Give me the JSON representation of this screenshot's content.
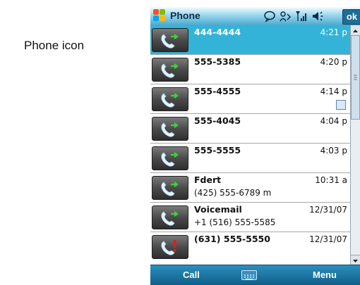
{
  "caption": "Phone icon",
  "titlebar": {
    "title": "Phone",
    "ok_label": "ok"
  },
  "calls": [
    {
      "name": "444-4444",
      "time": "4:21 p",
      "sub": "",
      "missed": false,
      "selected": true,
      "note": false
    },
    {
      "name": "555-5385",
      "time": "4:20 p",
      "sub": "",
      "missed": false,
      "selected": false,
      "note": false
    },
    {
      "name": "555-4555",
      "time": "4:14 p",
      "sub": "",
      "missed": false,
      "selected": false,
      "note": true
    },
    {
      "name": "555-4045",
      "time": "4:04 p",
      "sub": "",
      "missed": false,
      "selected": false,
      "note": false
    },
    {
      "name": "555-5555",
      "time": "4:03 p",
      "sub": "",
      "missed": false,
      "selected": false,
      "note": false
    },
    {
      "name": "Fdert",
      "time": "10:31 a",
      "sub": "(425) 555-6789 m",
      "missed": false,
      "selected": false,
      "note": false
    },
    {
      "name": "Voicemail",
      "time": "12/31/07",
      "sub": "+1 (516) 555-5585",
      "missed": false,
      "selected": false,
      "note": false
    },
    {
      "name": "(631) 555-5550",
      "time": "12/31/07",
      "sub": "",
      "missed": true,
      "selected": false,
      "note": false
    }
  ],
  "softkeys": {
    "left": "Call",
    "right": "Menu"
  },
  "colors": {
    "selected_row": "#33b3d7",
    "softkey_bar": "#0f5d86",
    "call_arrow": "#3bd23b",
    "missed_mark": "#e01b1b"
  }
}
